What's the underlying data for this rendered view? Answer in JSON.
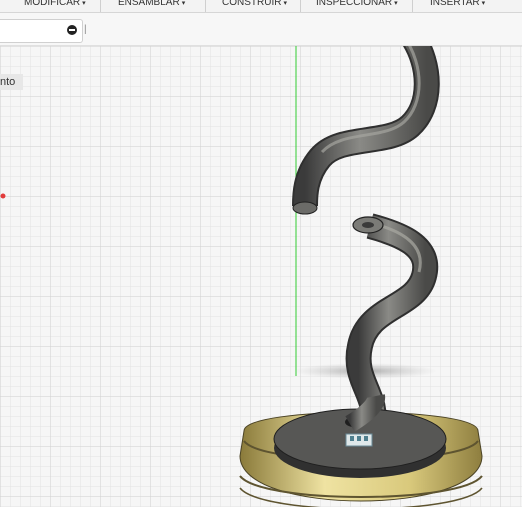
{
  "menu": [
    {
      "label": "MODIFICAR",
      "caret": "▾"
    },
    {
      "label": "ENSAMBLAR",
      "caret": "▾"
    },
    {
      "label": "CONSTRUIR",
      "caret": "▾"
    },
    {
      "label": "INSPECCIONAR",
      "caret": "▾"
    },
    {
      "label": "INSERTAR",
      "caret": "▾"
    }
  ],
  "tab": {
    "close_icon": "minus-circle-icon",
    "more_text": "|"
  },
  "browser": {
    "label": "nto"
  },
  "viewport": {
    "sketch_marker_color": "#e23b3b",
    "axis_color": "#33cc33",
    "grid_color": "#d9d9d9"
  }
}
